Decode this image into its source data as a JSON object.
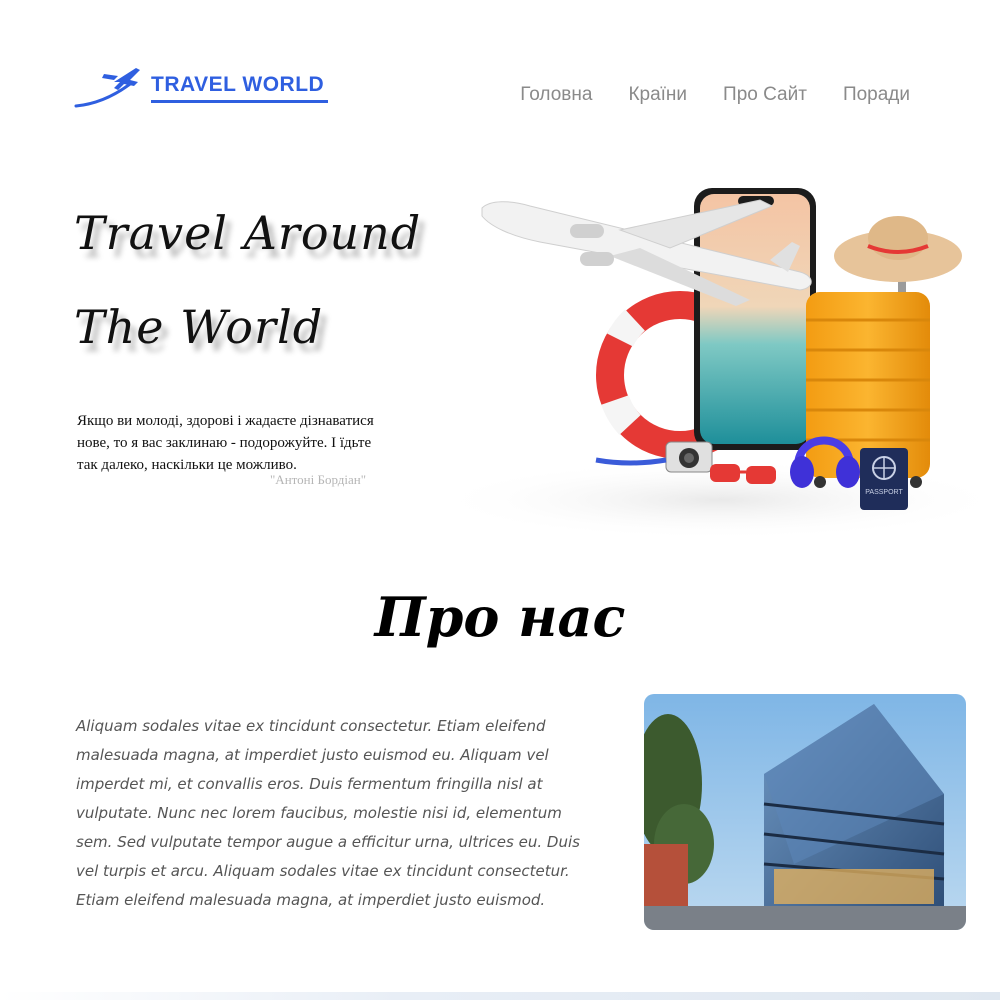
{
  "header": {
    "logo_text": "TRAVEL WORLD",
    "nav": [
      "Головна",
      "Країни",
      "Про Сайт",
      "Поради"
    ]
  },
  "hero": {
    "title_line1": "Travel Around",
    "title_line2": "The World",
    "quote": "Якщо ви молоді, здорові і жадаєте дізнаватися нове, то я вас заклинаю - подорожуйте. І їдьте так далеко, наскільки це можливо.",
    "quote_author": "\"Антоні Бордіан\"",
    "illustration_icons": [
      "airplane-icon",
      "phone-icon",
      "lifebuoy-icon",
      "suitcase-icon",
      "sun-hat-icon",
      "camera-icon",
      "sunglasses-icon",
      "headphones-icon",
      "passport-icon"
    ],
    "passport_label": "PASSPORT"
  },
  "about": {
    "title": "Про нас",
    "text": "Aliquam sodales vitae ex tincidunt consectetur. Etiam eleifend malesuada magna, at imperdiet justo euismod eu. Aliquam vel imperdet mi, et convallis eros. Duis fermentum fringilla nisl at vulputate. Nunc nec lorem faucibus, molestie nisi id, elementum sem. Sed vulputate tempor augue a efficitur urna, ultrices eu. Duis vel turpis et arcu. Aliquam sodales vitae ex tincidunt consectetur. Etiam eleifend malesuada magna, at imperdiet justo euismod.",
    "photo": "office-building-photo"
  },
  "colors": {
    "brand": "#2f5fe0",
    "nav_text": "#8a8a8a",
    "suitcase": "#f5a623",
    "lifebuoy": "#e53935"
  }
}
